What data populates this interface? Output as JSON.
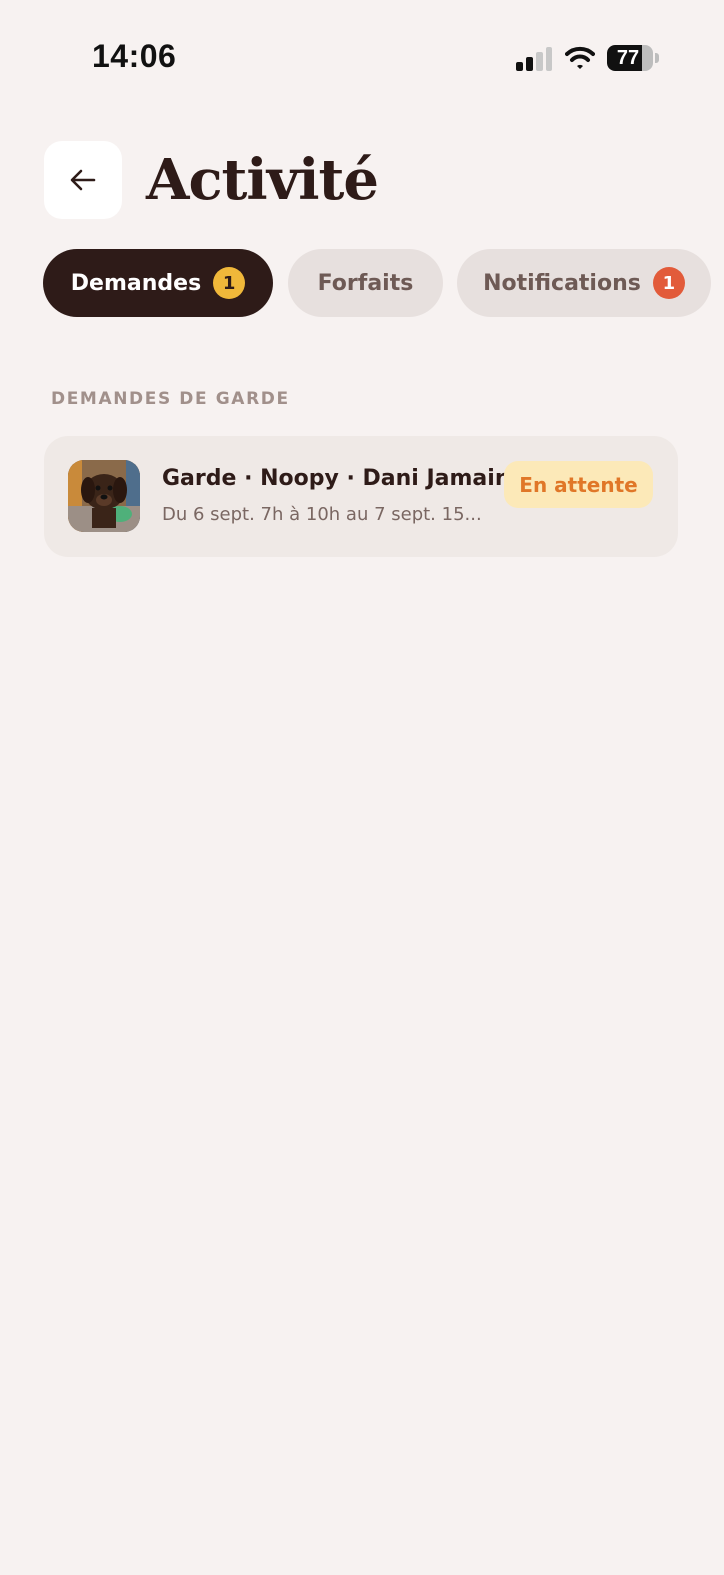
{
  "status_bar": {
    "time": "14:06",
    "battery": "77",
    "battery_level": 0.77
  },
  "header": {
    "title": "Activité",
    "back_icon": "arrow-left-icon"
  },
  "tabs": [
    {
      "label": "Demandes",
      "badge": "1",
      "active": true
    },
    {
      "label": "Forfaits",
      "badge": "",
      "active": false
    },
    {
      "label": "Notifications",
      "badge": "1",
      "active": false
    }
  ],
  "section": {
    "label": "DEMANDES DE GARDE",
    "requests": [
      {
        "title": "Garde · Noopy · Dani Jamain",
        "subtitle": "Du 6 sept. 7h à 10h au 7 sept. 15...",
        "status": "En attente"
      }
    ]
  },
  "colors": {
    "background": "#F7F2F1",
    "primary_dark": "#2E1B18",
    "tab_inactive": "#E7E0DE",
    "badge_yellow": "#F0B83A",
    "badge_red": "#E25B3A",
    "status_pending_bg": "#FCE9B8",
    "status_pending_text": "#E07728"
  }
}
